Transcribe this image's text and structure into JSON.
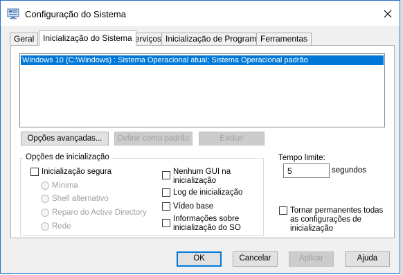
{
  "window": {
    "title": "Configuração do Sistema",
    "close_icon": "close-icon",
    "app_icon": "system-config-icon"
  },
  "tabs": [
    {
      "label": "Geral",
      "active": false
    },
    {
      "label": "Inicialização do Sistema",
      "active": true
    },
    {
      "label": "Serviços",
      "active": false
    },
    {
      "label": "Inicialização de Programas",
      "active": false
    },
    {
      "label": "Ferramentas",
      "active": false
    }
  ],
  "boot": {
    "os_entries": [
      "Windows 10 (C:\\Windows) : Sistema Operacional atual; Sistema Operacional padrão"
    ],
    "buttons": {
      "advanced": "Opções avançadas...",
      "set_default": "Definir como padrão",
      "delete": "Excluir"
    },
    "options_group": {
      "title": "Opções de inicialização",
      "safe_boot": {
        "label": "Inicialização segura",
        "checked": false
      },
      "radios": [
        {
          "label": "Mínima",
          "enabled": false
        },
        {
          "label": "Shell alternativo",
          "enabled": false
        },
        {
          "label": "Reparo do Active Directory",
          "enabled": false
        },
        {
          "label": "Rede",
          "enabled": false
        }
      ],
      "no_gui": {
        "label_line1": "Nenhum GUI na",
        "label_line2": "inicialização",
        "checked": false
      },
      "boot_log": {
        "label": "Log de inicialização",
        "checked": false
      },
      "base_video": {
        "label": "Vídeo base",
        "checked": false
      },
      "os_info": {
        "label_line1": "Informações sobre",
        "label_line2": "inicialização do SO",
        "checked": false
      }
    },
    "timeout": {
      "label": "Tempo limite:",
      "value": "5",
      "unit": "segundos"
    },
    "make_permanent": {
      "label_line1": "Tornar permanentes todas",
      "label_line2": "as configurações de",
      "label_line3": "inicialização",
      "checked": false
    }
  },
  "footer": {
    "ok": "OK",
    "cancel": "Cancelar",
    "apply": "Aplicar",
    "help": "Ajuda"
  },
  "colors": {
    "accent": "#0078d7",
    "window_border": "#1f6fc5",
    "dialog_bg": "#f0f0f0"
  }
}
